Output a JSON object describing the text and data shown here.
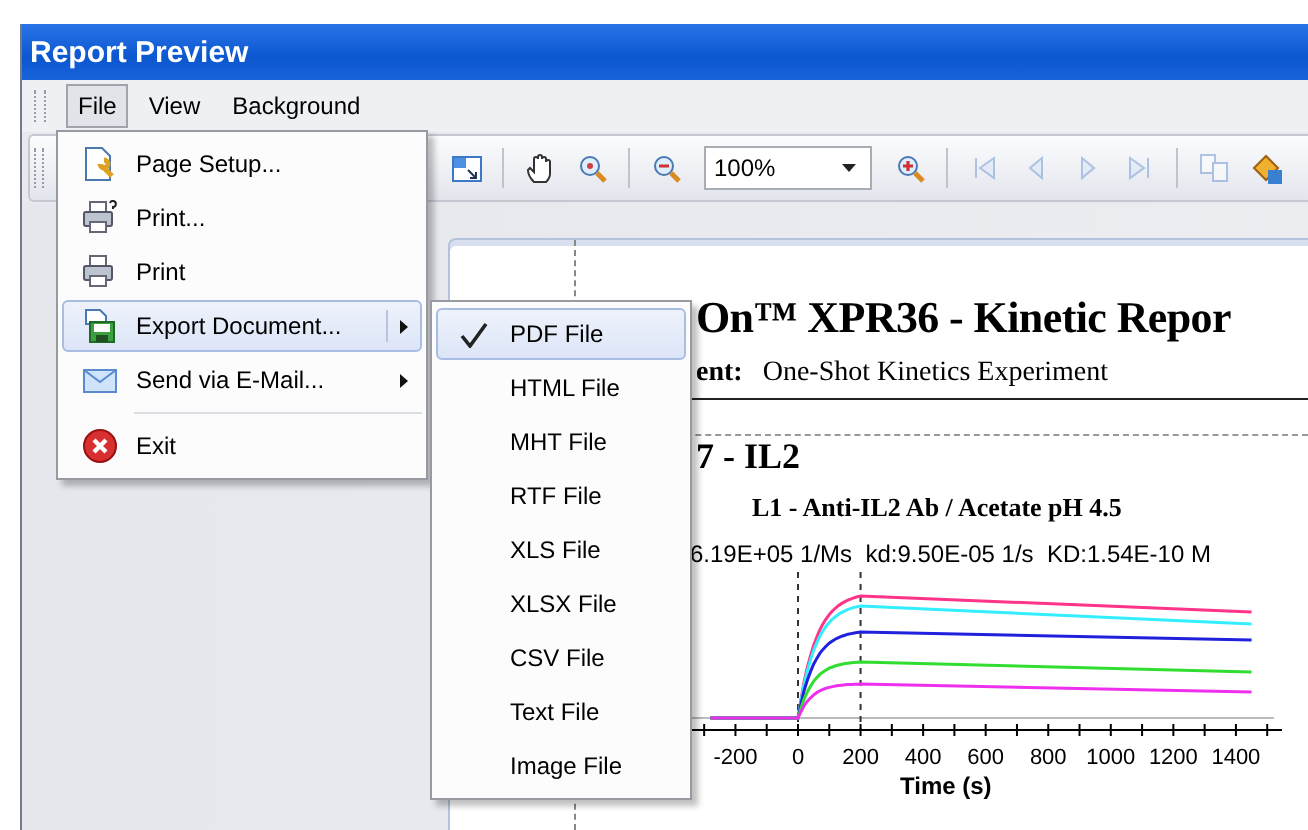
{
  "window": {
    "title": "Report Preview"
  },
  "menu_bar": [
    {
      "label": "File",
      "selected": true
    },
    {
      "label": "View",
      "selected": false
    },
    {
      "label": "Background",
      "selected": false
    }
  ],
  "toolbar": {
    "buttons": [
      {
        "kind": "fit",
        "disabled": false
      },
      {
        "kind": "separator"
      },
      {
        "kind": "hand",
        "disabled": false
      },
      {
        "kind": "magnifier",
        "disabled": false
      },
      {
        "kind": "separator"
      },
      {
        "kind": "zoom-out",
        "disabled": false
      },
      {
        "kind": "combo",
        "value": "100%",
        "disabled": false
      },
      {
        "kind": "zoom-in",
        "disabled": false
      },
      {
        "kind": "separator"
      },
      {
        "kind": "first",
        "disabled": true
      },
      {
        "kind": "previous",
        "disabled": true
      },
      {
        "kind": "next",
        "disabled": true
      },
      {
        "kind": "last",
        "disabled": true
      },
      {
        "kind": "separator"
      },
      {
        "kind": "pages",
        "disabled": true
      },
      {
        "kind": "fill",
        "disabled": false
      }
    ]
  },
  "file_menu": [
    {
      "kind": "item",
      "label": "Page Setup...",
      "submenu": false,
      "selected": false
    },
    {
      "kind": "item",
      "label": "Print...",
      "submenu": false,
      "selected": false
    },
    {
      "kind": "item",
      "label": "Print",
      "submenu": false,
      "selected": false
    },
    {
      "kind": "item",
      "label": "Export Document...",
      "submenu": true,
      "selected": true
    },
    {
      "kind": "item",
      "label": "Send via E-Mail...",
      "submenu": true,
      "selected": false
    },
    {
      "kind": "separator"
    },
    {
      "kind": "item",
      "label": "Exit",
      "submenu": false,
      "selected": false
    }
  ],
  "export_menu": [
    {
      "label": "PDF File",
      "checked": true,
      "selected": true
    },
    {
      "label": "HTML File",
      "checked": false,
      "selected": false
    },
    {
      "label": "MHT File",
      "checked": false,
      "selected": false
    },
    {
      "label": "RTF File",
      "checked": false,
      "selected": false
    },
    {
      "label": "XLS File",
      "checked": false,
      "selected": false
    },
    {
      "label": "XLSX File",
      "checked": false,
      "selected": false
    },
    {
      "label": "CSV File",
      "checked": false,
      "selected": false
    },
    {
      "label": "Text File",
      "checked": false,
      "selected": false
    },
    {
      "label": "Image File",
      "checked": false,
      "selected": false
    }
  ],
  "page": {
    "title": "On™ XPR36 - Kinetic Repor",
    "experiment_label": "ent:",
    "experiment": "One-Shot Kinetics Experiment",
    "section": "7 - IL2",
    "chart_title": "L1 - Anti-IL2 Ab / Acetate pH 4.5",
    "parameters": "6.19E+05 1/Ms  kd:9.50E-05 1/s  KD:1.54E-10 M",
    "x_tick_labels": [
      "-200",
      "0",
      "200",
      "400",
      "600",
      "800",
      "1000",
      "1200",
      "1400"
    ],
    "x_label": "Time (s)"
  }
}
